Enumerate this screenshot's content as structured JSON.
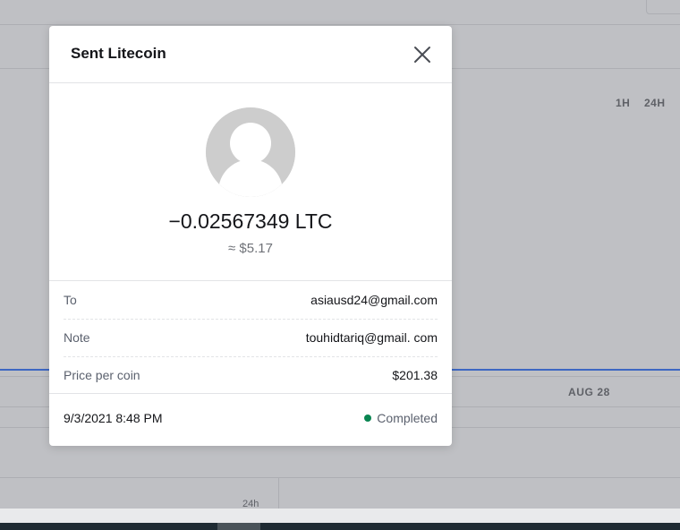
{
  "background": {
    "timeframes": [
      "1H",
      "24H"
    ],
    "axis_date": "AUG 28",
    "panel_label": "24h",
    "chart_line_color": "#3d67c2"
  },
  "modal": {
    "title": "Sent Litecoin",
    "close_icon": "close-icon",
    "avatar_icon": "user-avatar-icon",
    "amount": "−0.02567349 LTC",
    "fiat": "≈ $5.17",
    "details": [
      {
        "label": "To",
        "value": "asiausd24@gmail.com"
      },
      {
        "label": "Note",
        "value": "touhidtariq@gmail. com"
      },
      {
        "label": "Price per coin",
        "value": "$201.38"
      }
    ],
    "date": "9/3/2021 8:48 PM",
    "status": "Completed",
    "status_color": "#098551"
  }
}
